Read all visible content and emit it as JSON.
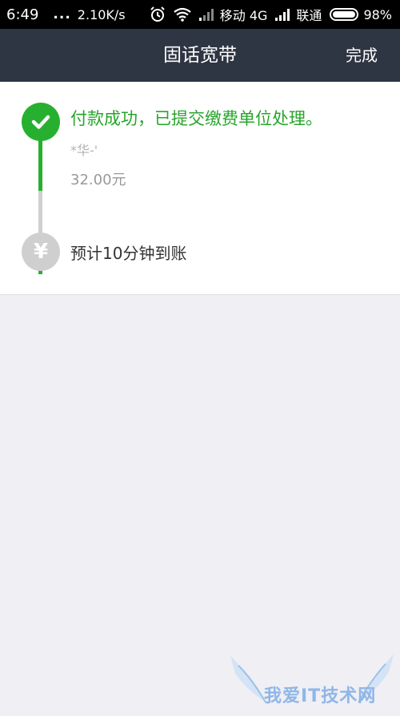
{
  "status_bar": {
    "time": "6:49",
    "dots": "...",
    "network_speed": "2.10K/s",
    "carrier1": "移动 4G",
    "carrier2": "联通",
    "battery_percent": "98%",
    "battery_level": 0.98
  },
  "header": {
    "title": "固话宽带",
    "done_label": "完成"
  },
  "progress": {
    "step1": {
      "title": "付款成功，已提交缴费单位处理。",
      "account": "*华-'",
      "amount": "32.00元",
      "status_color": "#27b02f"
    },
    "step2": {
      "title": "预计10分钟到账",
      "icon_symbol": "¥",
      "status_color": "#cfcfcf"
    }
  },
  "watermark": {
    "text": "我爱IT技术网"
  },
  "colors": {
    "header_bg": "#2e3543",
    "success_green": "#27b02f",
    "page_bg": "#efeff4"
  }
}
